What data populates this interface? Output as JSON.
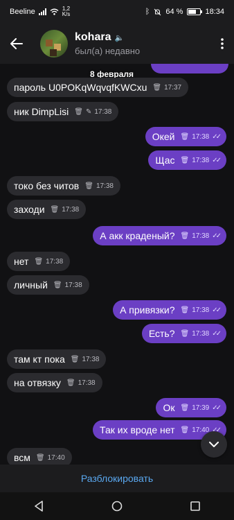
{
  "status": {
    "carrier": "Beeline",
    "speed_value": "1,2",
    "speed_unit": "K/s",
    "battery": "64 %",
    "battery_level": 64,
    "time": "18:34"
  },
  "header": {
    "name": "kohara",
    "last_seen": "был(а) недавно"
  },
  "chat": {
    "date_chip": "8 февраля",
    "messages": [
      {
        "text": "пароль U0POKqWqvqfKWCxu",
        "time": "17:37"
      },
      {
        "text": "ник DimpLisi",
        "time": "17:38"
      },
      {
        "text": "Окей",
        "time": "17:38"
      },
      {
        "text": "Щас",
        "time": "17:38"
      },
      {
        "text": "токо без читов",
        "time": "17:38"
      },
      {
        "text": "заходи",
        "time": "17:38"
      },
      {
        "text": "А акк краденый?",
        "time": "17:38"
      },
      {
        "text": "нет",
        "time": "17:38"
      },
      {
        "text": "личный",
        "time": "17:38"
      },
      {
        "text": "А привязки?",
        "time": "17:38"
      },
      {
        "text": "Есть?",
        "time": "17:38"
      },
      {
        "text": "там кт пока",
        "time": "17:38"
      },
      {
        "text": "на отвязку",
        "time": "17:38"
      },
      {
        "text": "Ок",
        "time": "17:39"
      },
      {
        "text": "Так их вроде нет",
        "time": "17:40"
      },
      {
        "text": "всм",
        "time": "17:40"
      }
    ]
  },
  "bottom": {
    "unblock_label": "Разблокировать"
  },
  "icons": {
    "delete": "trash-icon",
    "edit": "pencil-icon",
    "read": "double-check-icon"
  },
  "colors": {
    "outgoing_bubble": "#6b3fc4",
    "incoming_bubble": "#2b2b2f",
    "link": "#5aa8f0"
  }
}
